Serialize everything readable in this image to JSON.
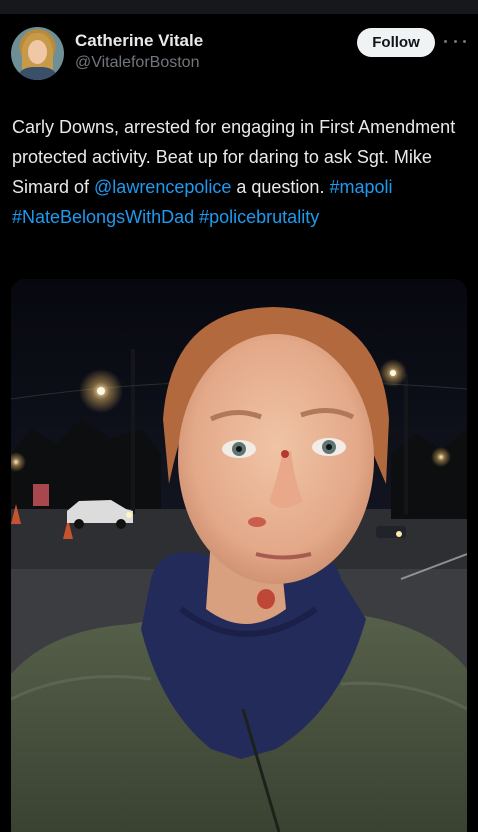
{
  "tweet": {
    "author_name": "Catherine Vitale",
    "author_handle": "@VitaleforBoston",
    "follow_label": "Follow",
    "text_parts": [
      {
        "text": "Carly Downs, arrested for engaging in First Amendment protected activity. Beat up for daring to ask Sgt. Mike Simard of ",
        "type": "text"
      },
      {
        "text": "@lawrencepolice",
        "type": "link"
      },
      {
        "text": " a question. ",
        "type": "text"
      },
      {
        "text": "#mapoli",
        "type": "link"
      },
      {
        "text": " ",
        "type": "text"
      },
      {
        "text": "#NateBelongsWithDad",
        "type": "link"
      },
      {
        "text": " ",
        "type": "text"
      },
      {
        "text": "#policebrutality",
        "type": "link"
      }
    ]
  },
  "icons": {
    "more": "more-dots-icon"
  },
  "colors": {
    "background": "#000000",
    "text": "#e7e9ea",
    "secondary": "#71767b",
    "link": "#1d9bf0",
    "follow_bg": "#eff3f4"
  }
}
